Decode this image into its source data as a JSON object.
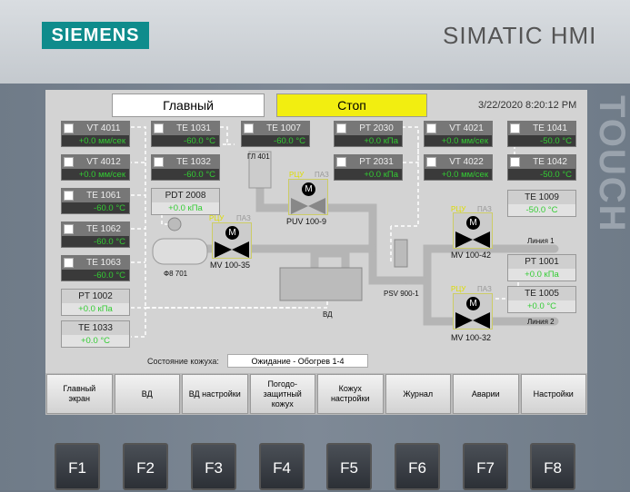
{
  "brand": {
    "logo": "SIEMENS",
    "product": "SIMATIC HMI",
    "touch": "TOUCH"
  },
  "header": {
    "screen_title": "Главный",
    "state": "Стоп",
    "datetime": "3/22/2020 8:20:12 PM"
  },
  "tags": [
    {
      "name": "VT 4011",
      "value": "+0.0 мм/сек"
    },
    {
      "name": "VT 4012",
      "value": "+0.0 мм/сек"
    },
    {
      "name": "TE 1061",
      "value": "-60.0 °C"
    },
    {
      "name": "TE 1062",
      "value": "-60.0 °C"
    },
    {
      "name": "TE 1063",
      "value": "-60.0 °C"
    },
    {
      "name": "TE 1031",
      "value": "-60.0 °C"
    },
    {
      "name": "TE 1032",
      "value": "-60.0 °C"
    },
    {
      "name": "TE 1007",
      "value": "-60.0 °C"
    },
    {
      "name": "PT 2030",
      "value": "+0.0 кПа"
    },
    {
      "name": "PT 2031",
      "value": "+0.0 кПа"
    },
    {
      "name": "VT 4021",
      "value": "+0.0 мм/сек"
    },
    {
      "name": "VT 4022",
      "value": "+0.0 мм/сек"
    },
    {
      "name": "TE 1041",
      "value": "-50.0 °C"
    },
    {
      "name": "TE 1042",
      "value": "-50.0 °C"
    }
  ],
  "ltags": [
    {
      "name": "PT 1002",
      "value": "+0.0 кПа"
    },
    {
      "name": "TE 1033",
      "value": "+0.0 °C"
    },
    {
      "name": "PDT 2008",
      "value": "+0.0 кПа"
    },
    {
      "name": "TE 1009",
      "value": "-50.0 °C"
    },
    {
      "name": "PT 1001",
      "value": "+0.0 кПа"
    },
    {
      "name": "TE 1005",
      "value": "+0.0 °C"
    }
  ],
  "valves": [
    {
      "name": "PUV 100-9"
    },
    {
      "name": "MV 100-35"
    },
    {
      "name": "MV 100-42"
    },
    {
      "name": "MV 100-32"
    }
  ],
  "valve_labels": {
    "rcu": "РЦУ",
    "paz": "ПАЗ",
    "motor": "M"
  },
  "labels": {
    "gl401": "ГЛ 401",
    "f8701": "Ф8 701",
    "vd": "ВД",
    "psv": "PSV 900-1",
    "line1": "Линия 1",
    "line2": "Линия 2"
  },
  "status": {
    "label": "Состояние кожуха:",
    "value": "Ожидание - Обогрев 1-4"
  },
  "nav": [
    "Главный\nэкран",
    "ВД",
    "ВД настройки",
    "Погодо-\nзащитный\nкожух",
    "Кожух\nнастройки",
    "Журнал",
    "Аварии",
    "Настройки"
  ],
  "fkeys": [
    "F1",
    "F2",
    "F3",
    "F4",
    "F5",
    "F6",
    "F7",
    "F8"
  ]
}
